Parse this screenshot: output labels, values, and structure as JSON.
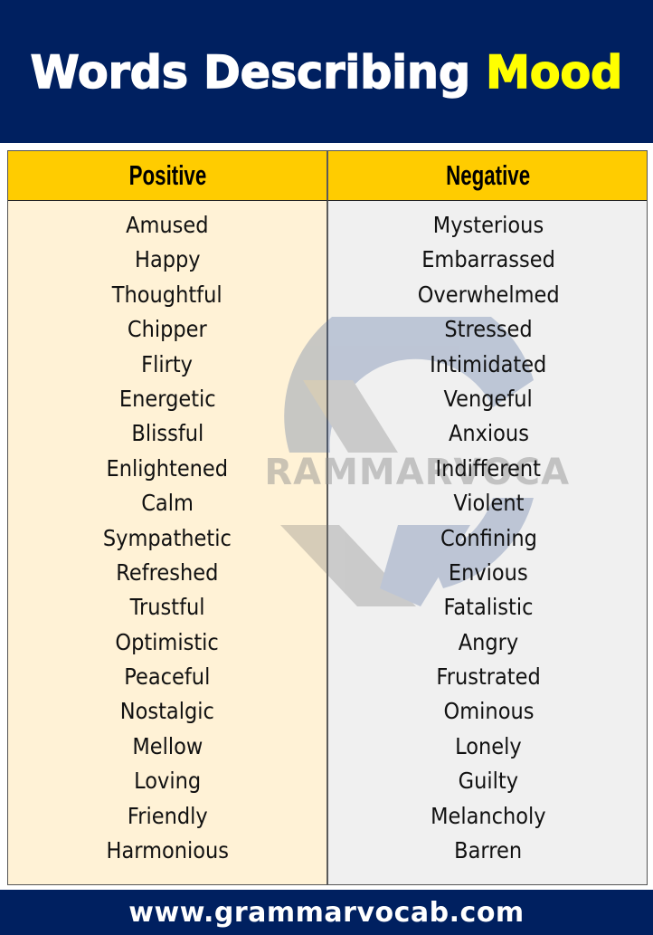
{
  "header": {
    "title_main": "Words Describing ",
    "title_highlight": "Mood",
    "background_color": "#002060",
    "highlight_color": "#FFFF00"
  },
  "table": {
    "columns": [
      {
        "header": "Positive",
        "background_color": "#FFF2D6",
        "words": [
          "Amused",
          "Happy",
          "Thoughtful",
          "Chipper",
          "Flirty",
          "Energetic",
          "Blissful",
          "Enlightened",
          "Calm",
          "Sympathetic",
          "Refreshed",
          "Trustful",
          "Optimistic",
          "Peaceful",
          "Nostalgic",
          "Mellow",
          "Loving",
          "Friendly",
          "Harmonious"
        ]
      },
      {
        "header": "Negative",
        "background_color": "#F0F0F0",
        "words": [
          "Mysterious",
          "Embarrassed",
          "Overwhelmed",
          "Stressed",
          "Intimidated",
          "Vengeful",
          "Anxious",
          "Indifferent",
          "Violent",
          "Confining",
          "Envious",
          "Fatalistic",
          "Angry",
          "Frustrated",
          "Ominous",
          "Lonely",
          "Guilty",
          "Melancholy",
          "Barren"
        ]
      }
    ],
    "header_color": "#FFCC00"
  },
  "watermark": {
    "text": "GRAMMARVOCAB",
    "icon": "grammarvocab-logo-icon"
  },
  "footer": {
    "url": "www.grammarvocab.com"
  }
}
